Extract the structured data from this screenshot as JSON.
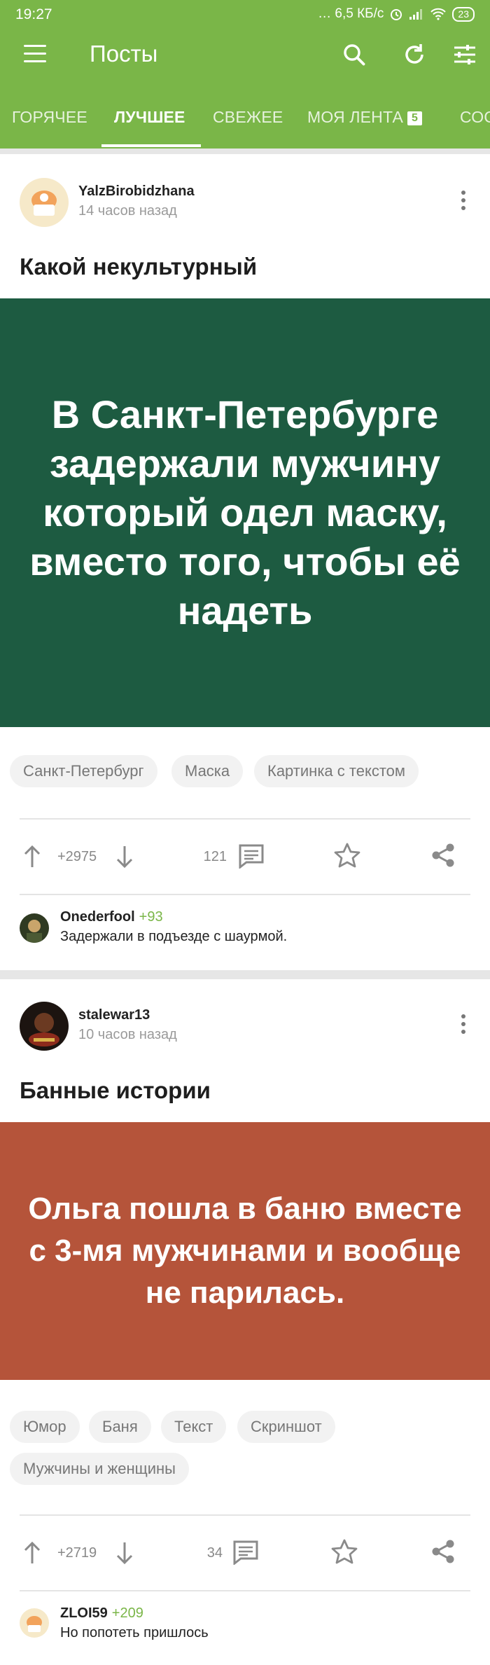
{
  "status": {
    "time": "19:27",
    "speed": "6,5 КБ/с",
    "battery": "23"
  },
  "toolbar": {
    "title": "Посты"
  },
  "tabs": [
    {
      "label": "ГОРЯЧЕЕ"
    },
    {
      "label": "ЛУЧШЕЕ"
    },
    {
      "label": "СВЕЖЕЕ"
    },
    {
      "label": "МОЯ ЛЕНТА",
      "badge": "5"
    },
    {
      "label": "СОО"
    }
  ],
  "posts": [
    {
      "author": "YalzBirobidzhana",
      "time": "14 часов назад",
      "title": "Какой некультурный",
      "image_text": "В Санкт-Петербурге задержали мужчину который одел маску, вместо того, чтобы её надеть",
      "image_color": "#1d5b41",
      "tags": [
        "Санкт-Петербург",
        "Маска",
        "Картинка с текстом"
      ],
      "rating": "+2975",
      "comments": "121",
      "comment": {
        "author": "Onederfool",
        "score": "+93",
        "text": "Задержали в подъезде с шаурмой."
      }
    },
    {
      "author": "stalewar13",
      "time": "10 часов назад",
      "title": "Банные истории",
      "image_text": "Ольга пошла в баню вместе с 3-мя мужчинами и вообще не парилась.",
      "image_color": "#b5543a",
      "tags": [
        "Юмор",
        "Баня",
        "Текст",
        "Скриншот",
        "Мужчины и женщины"
      ],
      "rating": "+2719",
      "comments": "34",
      "comment": {
        "author": "ZLOI59",
        "score": "+209",
        "text": "Но попотеть пришлось"
      }
    }
  ],
  "colors": {
    "accent": "#7ab648"
  }
}
